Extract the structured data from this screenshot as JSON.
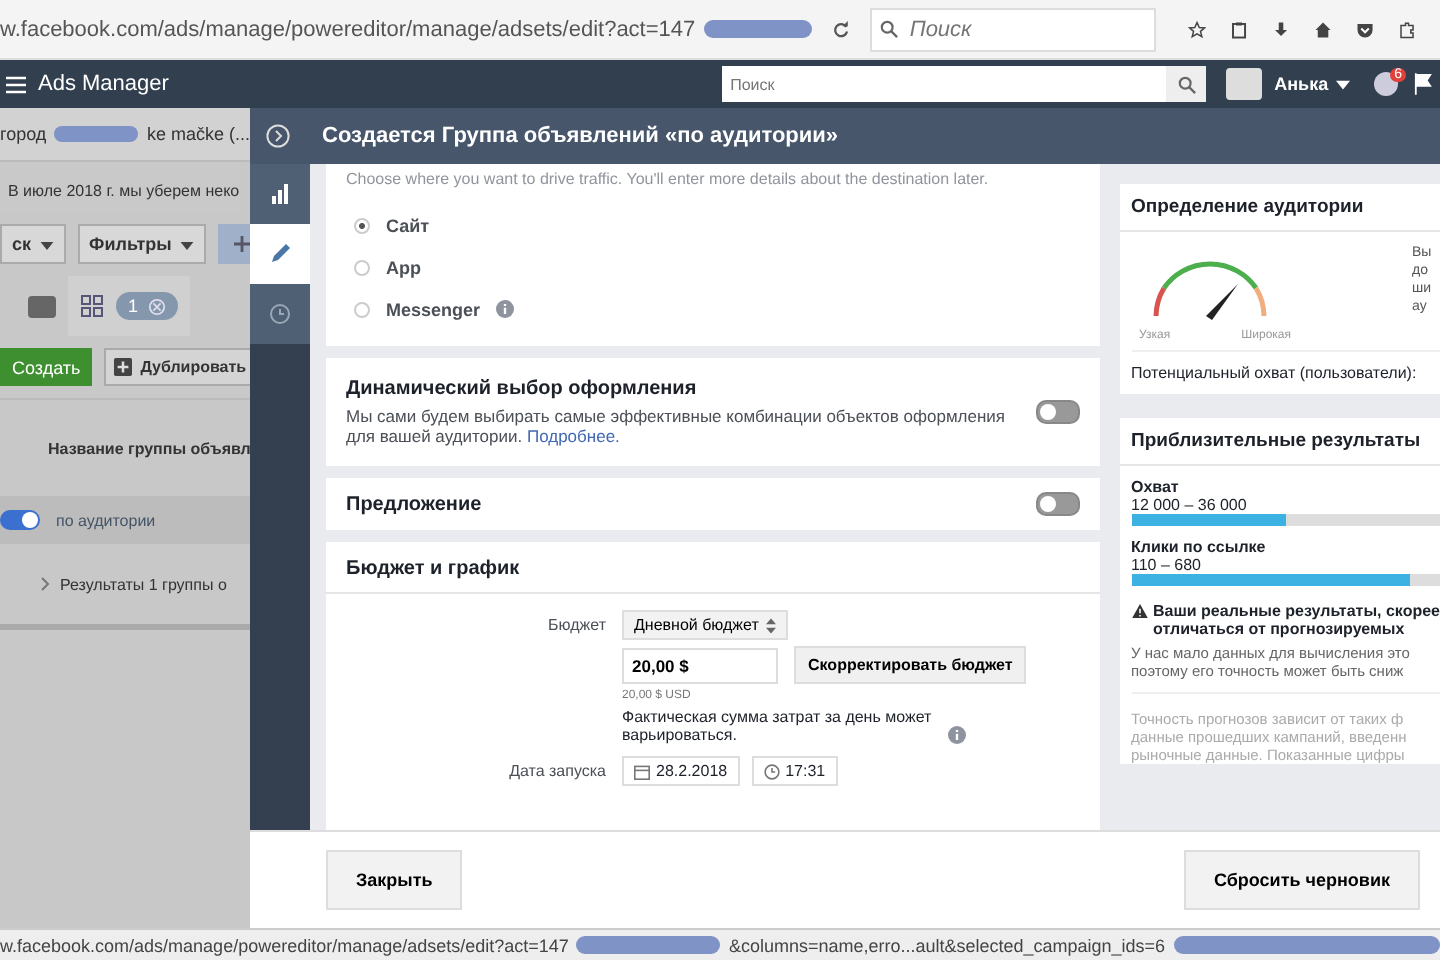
{
  "browser": {
    "url": "w.facebook.com/ads/manage/powereditor/manage/adsets/edit?act=147",
    "search": {
      "placeholder": "Поиск"
    }
  },
  "header": {
    "app": "Ads Manager",
    "search": {
      "placeholder": "Поиск"
    },
    "user": "Анька",
    "notifications": "6"
  },
  "background": {
    "campaign_prefix": "город",
    "campaign_suffix": "ke mačke (...",
    "notice": "В июле 2018 г. мы уберем неко",
    "toolbar": [
      "ск",
      "Фильтры"
    ],
    "selected_count": "1",
    "create": "Создать",
    "duplicate": "Дублировать",
    "column": "Название группы объявл",
    "rows": [
      {
        "name": "по аудитории",
        "on": true
      }
    ],
    "results": "Результаты 1 группы о"
  },
  "modal": {
    "title": "Создается Группа объявлений «по аудитории»",
    "rail": [
      {
        "selected": false
      },
      {
        "selected": true
      },
      {
        "selected": false
      }
    ],
    "traffic": {
      "hint": "Choose where you want to drive traffic. You'll enter more details about the destination later.",
      "options": [
        {
          "label": "Сайт",
          "selected": true,
          "info": false
        },
        {
          "label": "App",
          "selected": false,
          "info": false
        },
        {
          "label": "Messenger",
          "selected": false,
          "info": true
        }
      ]
    },
    "dynamic": {
      "title": "Динамический выбор оформления",
      "text": "Мы сами будем выбирать самые эффективные комбинации объектов оформления для вашей аудитории.",
      "link": "Подробнее.",
      "on": false
    },
    "offer": {
      "title": "Предложение",
      "on": false
    },
    "budget": {
      "title": "Бюджет и график",
      "label": "Бюджет",
      "type": "Дневной бюджет",
      "amount": "20,00 $",
      "adjust": "Скорректировать бюджет",
      "currency": "20,00 $ USD",
      "note": "Фактическая сумма затрат за день может варьироваться.",
      "start_label": "Дата запуска",
      "date": "28.2.2018",
      "time": "17:31"
    },
    "audience": {
      "title": "Определение аудитории",
      "narrow": "Узкая",
      "wide": "Широкая",
      "side_lines": [
        "Вы",
        "до",
        "ши",
        "ау"
      ],
      "reach_label": "Потенциальный охват (пользователи):"
    },
    "estimates": {
      "title": "Приблизительные результаты",
      "metrics": [
        {
          "name": "Охват",
          "range": "12 000 – 36 000",
          "level": 0.5
        },
        {
          "name": "Клики по ссылке",
          "range": "110 – 680",
          "level": 0.9
        }
      ],
      "warning_lines": [
        "Ваши реальные результаты, скорее",
        "отличаться от прогнозируемых"
      ],
      "info_lines": [
        "У нас мало данных для вычисления это",
        "поэтому его точность может быть сниж"
      ],
      "accuracy_lines": [
        "Точность прогнозов зависит от таких ф",
        "данные прошедших кампаний, введенн",
        "рыночные данные. Показанные цифры"
      ]
    },
    "close": "Закрыть",
    "reset": "Сбросить черновик"
  },
  "status_bar": {
    "url": "w.facebook.com/ads/manage/powereditor/manage/adsets/edit?act=147",
    "url_tail": "&columns=name,erro...ault&selected_campaign_ids=6"
  }
}
